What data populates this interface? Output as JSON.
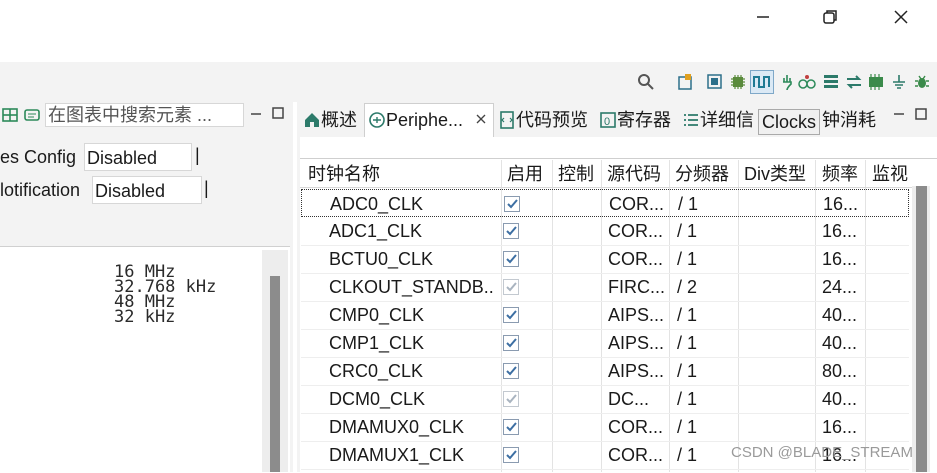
{
  "window": {
    "minimize_icon": "minimize-icon",
    "restore_icon": "restore-icon",
    "close_icon": "close-icon"
  },
  "left_panel": {
    "search_placeholder": "在图表中搜索元素 ...",
    "config_rows": [
      {
        "label": "es Config",
        "value": "Disabled"
      },
      {
        "label": "lotification",
        "value": "Disabled"
      }
    ],
    "frequencies": [
      "16 MHz",
      "32.768 kHz",
      "48 MHz",
      "32 kHz"
    ]
  },
  "tabs": [
    {
      "label": "概述",
      "icon": "home-icon"
    },
    {
      "label": "Periphe...",
      "icon": "peripheral-icon",
      "active": true
    },
    {
      "label": "代码预览",
      "icon": "code-preview-icon"
    },
    {
      "label": "寄存器",
      "icon": "register-icon"
    },
    {
      "label": "详细信",
      "icon": "details-icon"
    },
    {
      "label": "钟消耗",
      "icon": ""
    }
  ],
  "tooltip": "Clocks",
  "table": {
    "headers": [
      "时钟名称",
      "启用",
      "控制",
      "源代码",
      "分频器",
      "Div类型",
      "频率",
      "监视"
    ],
    "rows": [
      {
        "name": "ADC0_CLK",
        "enabled": true,
        "source": "COR...",
        "divider": "/ 1",
        "freq": "16..."
      },
      {
        "name": "ADC1_CLK",
        "enabled": true,
        "source": "COR...",
        "divider": "/ 1",
        "freq": "16..."
      },
      {
        "name": "BCTU0_CLK",
        "enabled": true,
        "source": "COR...",
        "divider": "/ 1",
        "freq": "16..."
      },
      {
        "name": "CLKOUT_STANDB...",
        "enabled": true,
        "disabled_look": true,
        "source": "FIRC...",
        "divider": "/ 2",
        "freq": "24..."
      },
      {
        "name": "CMP0_CLK",
        "enabled": true,
        "source": "AIPS...",
        "divider": "/ 1",
        "freq": "40..."
      },
      {
        "name": "CMP1_CLK",
        "enabled": true,
        "source": "AIPS...",
        "divider": "/ 1",
        "freq": "40..."
      },
      {
        "name": "CRC0_CLK",
        "enabled": true,
        "source": "AIPS...",
        "divider": "/ 1",
        "freq": "80..."
      },
      {
        "name": "DCM0_CLK",
        "enabled": true,
        "disabled_look": true,
        "source": "DC...",
        "divider": "/ 1",
        "freq": "40..."
      },
      {
        "name": "DMAMUX0_CLK",
        "enabled": true,
        "source": "COR...",
        "divider": "/ 1",
        "freq": "16..."
      },
      {
        "name": "DMAMUX1_CLK",
        "enabled": true,
        "source": "COR...",
        "divider": "/ 1",
        "freq": "16..."
      }
    ]
  },
  "watermark": "CSDN @BLADE_STREAM",
  "colors": {
    "toolbar_bg": "#f3f3f3",
    "accent": "#1f7a94",
    "check": "#3d6fa3"
  }
}
